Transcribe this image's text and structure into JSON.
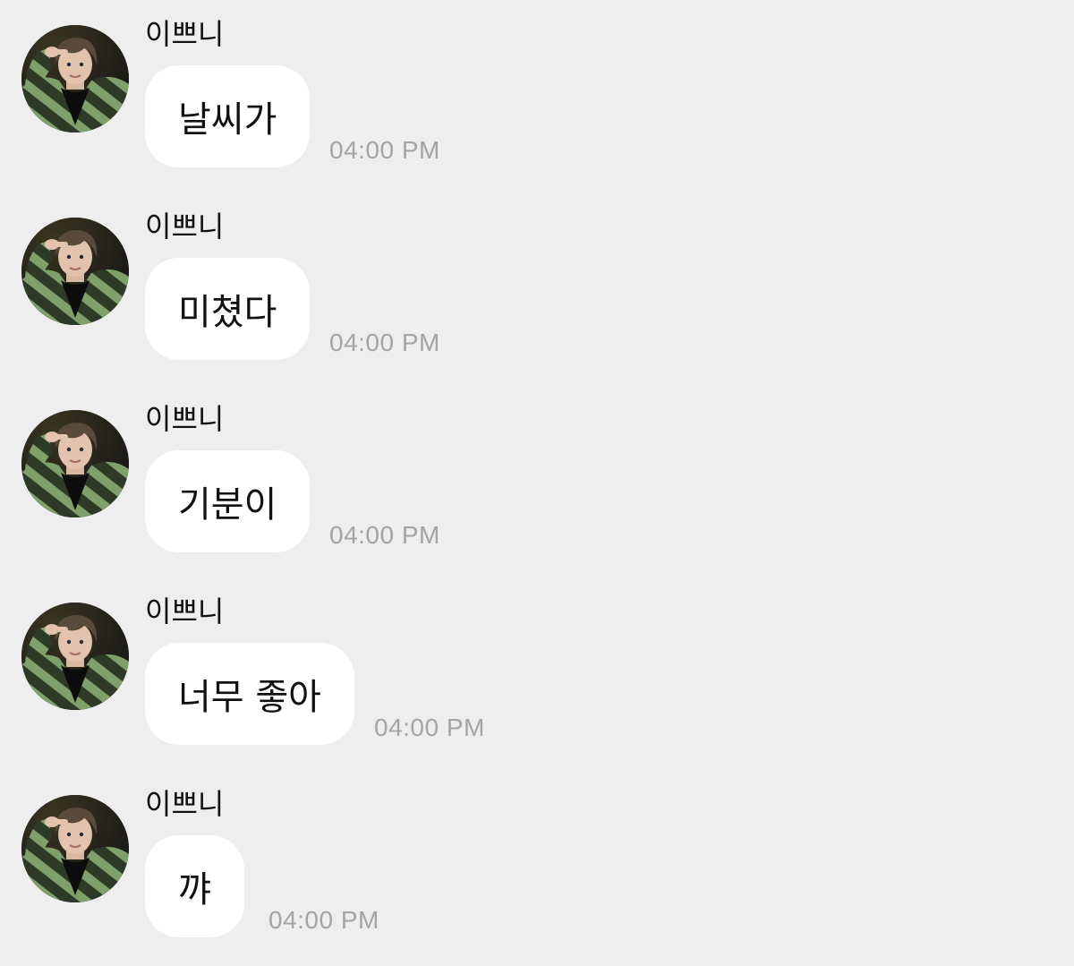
{
  "messages": [
    {
      "sender": "이쁘니",
      "text": "날씨가",
      "time": "04:00 PM"
    },
    {
      "sender": "이쁘니",
      "text": "미쳤다",
      "time": "04:00 PM"
    },
    {
      "sender": "이쁘니",
      "text": "기분이",
      "time": "04:00 PM"
    },
    {
      "sender": "이쁘니",
      "text": "너무 좋아",
      "time": "04:00 PM"
    },
    {
      "sender": "이쁘니",
      "text": "꺄",
      "time": "04:00 PM"
    }
  ],
  "colors": {
    "background": "#eeeeee",
    "bubble": "#ffffff",
    "timestamp": "#a4a4a4"
  },
  "avatar_icon": "profile-photo-avatar"
}
